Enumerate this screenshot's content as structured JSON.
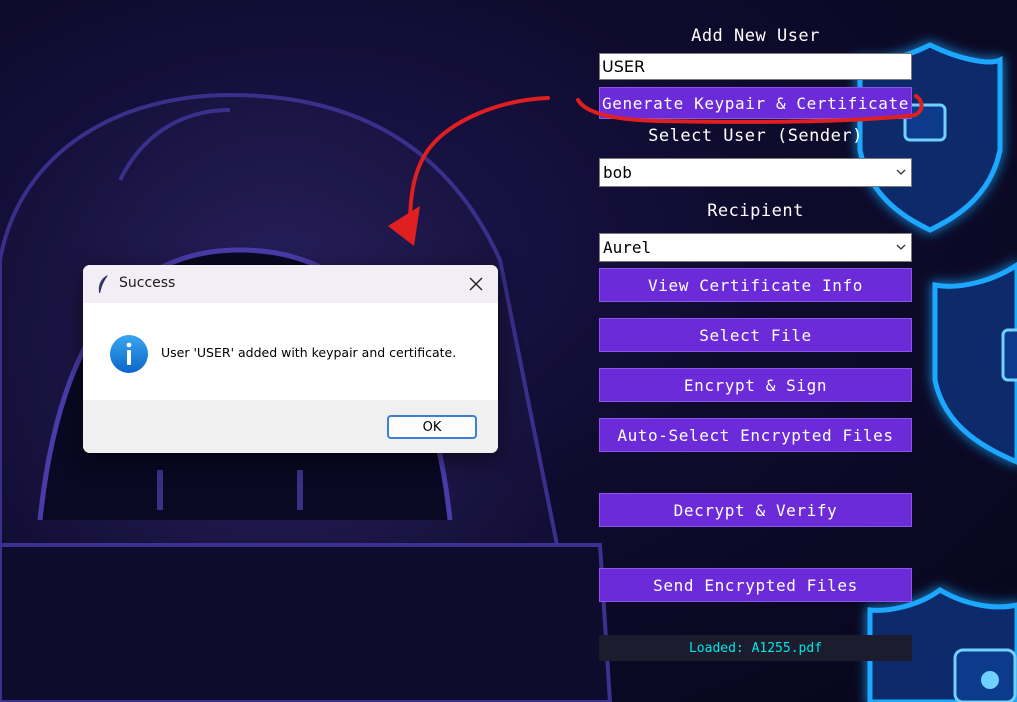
{
  "panel": {
    "add_user_label": "Add New User",
    "username_value": "USER",
    "generate_button": "Generate Keypair & Certificate",
    "sender_label": "Select User (Sender)",
    "sender_value": "bob",
    "recipient_label": "Recipient",
    "recipient_value": "Aurel",
    "buttons": {
      "view_cert": "View Certificate Info",
      "select_file": "Select File",
      "encrypt_sign": "Encrypt & Sign",
      "auto_select": "Auto-Select Encrypted Files",
      "decrypt_verify": "Decrypt & Verify",
      "send_files": "Send Encrypted Files"
    },
    "status_text": "Loaded: A1255.pdf"
  },
  "dialog": {
    "title": "Success",
    "message": "User 'USER' added with keypair and certificate.",
    "ok_label": "OK",
    "icon": "info-icon"
  },
  "icons": {
    "dialog_app_icon": "feather-icon",
    "dialog_close": "close-icon",
    "dropdown": "chevron-down-icon"
  },
  "colors": {
    "button_bg": "#6c2bd9",
    "status_text": "#00e6e6",
    "annotation": "#e02020",
    "shield_glow": "#1aa8ff"
  }
}
